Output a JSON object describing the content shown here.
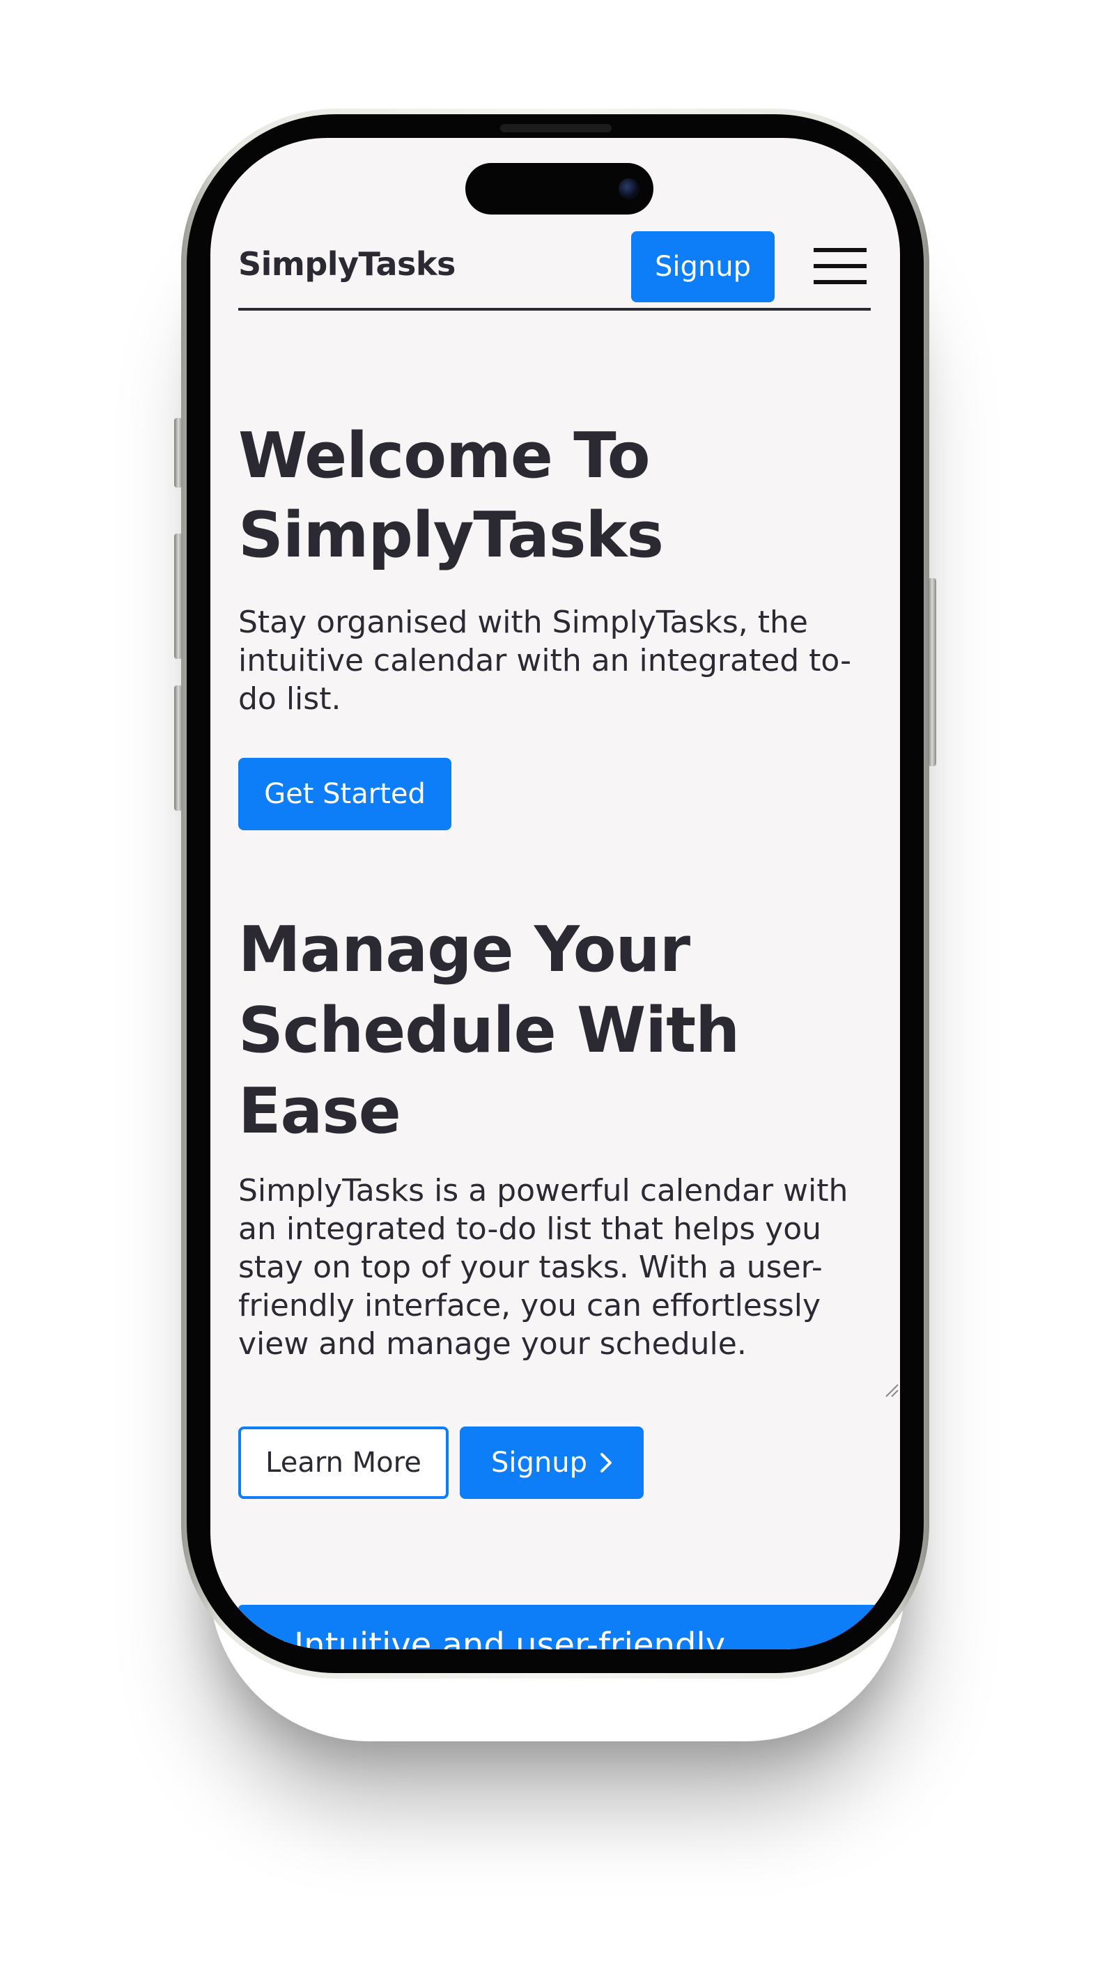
{
  "navbar": {
    "brand": "SimplyTasks",
    "signup_label": "Signup",
    "menu_icon": "hamburger-menu-icon"
  },
  "hero": {
    "title_line1": "Welcome To",
    "title_line2": "SimplyTasks",
    "description": "Stay organised with SimplyTasks, the intuitive calendar with an integrated to-do list.",
    "cta_label": "Get Started"
  },
  "feature": {
    "title_line1": "Manage Your",
    "title_line2": "Schedule With",
    "title_line3": "Ease",
    "description": "SimplyTasks is a powerful calendar with an integrated to-do list that helps you stay on top of your tasks. With a user-friendly interface, you can effortlessly view and manage your schedule.",
    "learn_more_label": "Learn More",
    "signup_label": "Signup",
    "signup_icon": "chevron-right-icon"
  },
  "accordion": {
    "label": "Intuitive and user-friendly",
    "caret_icon": "caret-down-icon"
  },
  "colors": {
    "primary": "#0d7ef8",
    "text": "#2b2a33",
    "background": "#f7f5f6"
  }
}
